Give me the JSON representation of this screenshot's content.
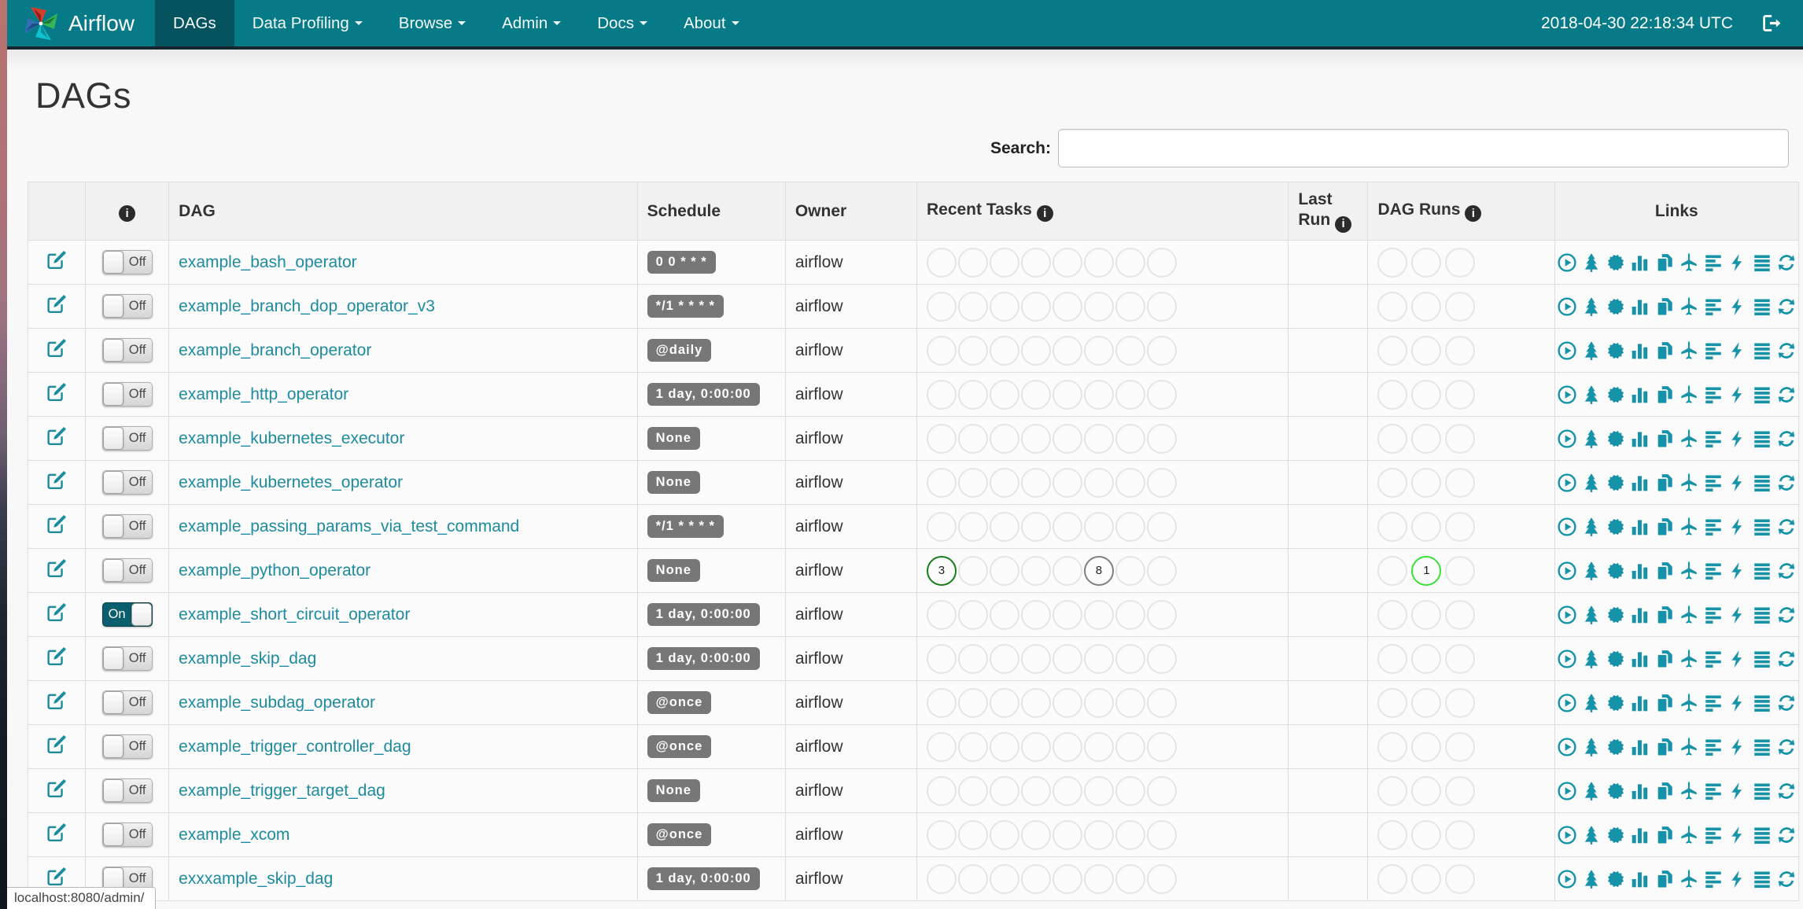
{
  "navbar": {
    "brand": "Airflow",
    "items": [
      {
        "label": "DAGs",
        "active": true,
        "caret": false
      },
      {
        "label": "Data Profiling",
        "active": false,
        "caret": true
      },
      {
        "label": "Browse",
        "active": false,
        "caret": true
      },
      {
        "label": "Admin",
        "active": false,
        "caret": true
      },
      {
        "label": "Docs",
        "active": false,
        "caret": true
      },
      {
        "label": "About",
        "active": false,
        "caret": true
      }
    ],
    "clock": "2018-04-30 22:18:34 UTC"
  },
  "page": {
    "title": "DAGs",
    "search_label": "Search:",
    "search_value": "",
    "status_bar": "localhost:8080/admin/"
  },
  "table": {
    "headers": {
      "dag": "DAG",
      "schedule": "Schedule",
      "owner": "Owner",
      "recent_tasks": "Recent Tasks",
      "last_run_line1": "Last",
      "last_run_line2": "Run",
      "dag_runs": "DAG Runs",
      "links": "Links"
    },
    "recent_task_slots": 8,
    "dag_run_slots": 3,
    "link_icons": [
      "trigger-dag",
      "tree-view",
      "graph-view",
      "task-duration",
      "task-tries",
      "landing-times",
      "gantt-view",
      "code-view",
      "task-details",
      "refresh"
    ],
    "rows": [
      {
        "toggle": "Off",
        "dag": "example_bash_operator",
        "schedule": "0 0 * * *",
        "owner": "airflow",
        "recent": {},
        "runs": {}
      },
      {
        "toggle": "Off",
        "dag": "example_branch_dop_operator_v3",
        "schedule": "*/1 * * * *",
        "owner": "airflow",
        "recent": {},
        "runs": {}
      },
      {
        "toggle": "Off",
        "dag": "example_branch_operator",
        "schedule": "@daily",
        "owner": "airflow",
        "recent": {},
        "runs": {}
      },
      {
        "toggle": "Off",
        "dag": "example_http_operator",
        "schedule": "1 day, 0:00:00",
        "owner": "airflow",
        "recent": {},
        "runs": {}
      },
      {
        "toggle": "Off",
        "dag": "example_kubernetes_executor",
        "schedule": "None",
        "owner": "airflow",
        "recent": {},
        "runs": {}
      },
      {
        "toggle": "Off",
        "dag": "example_kubernetes_operator",
        "schedule": "None",
        "owner": "airflow",
        "recent": {},
        "runs": {}
      },
      {
        "toggle": "Off",
        "dag": "example_passing_params_via_test_command",
        "schedule": "*/1 * * * *",
        "owner": "airflow",
        "recent": {},
        "runs": {}
      },
      {
        "toggle": "Off",
        "dag": "example_python_operator",
        "schedule": "None",
        "owner": "airflow",
        "recent": {
          "0": {
            "value": "3",
            "state": "success"
          },
          "5": {
            "value": "8",
            "state": "none"
          }
        },
        "runs": {
          "1": {
            "value": "1",
            "state": "running"
          }
        }
      },
      {
        "toggle": "On",
        "dag": "example_short_circuit_operator",
        "schedule": "1 day, 0:00:00",
        "owner": "airflow",
        "recent": {},
        "runs": {}
      },
      {
        "toggle": "Off",
        "dag": "example_skip_dag",
        "schedule": "1 day, 0:00:00",
        "owner": "airflow",
        "recent": {},
        "runs": {}
      },
      {
        "toggle": "Off",
        "dag": "example_subdag_operator",
        "schedule": "@once",
        "owner": "airflow",
        "recent": {},
        "runs": {}
      },
      {
        "toggle": "Off",
        "dag": "example_trigger_controller_dag",
        "schedule": "@once",
        "owner": "airflow",
        "recent": {},
        "runs": {}
      },
      {
        "toggle": "Off",
        "dag": "example_trigger_target_dag",
        "schedule": "None",
        "owner": "airflow",
        "recent": {},
        "runs": {}
      },
      {
        "toggle": "Off",
        "dag": "example_xcom",
        "schedule": "@once",
        "owner": "airflow",
        "recent": {},
        "runs": {}
      },
      {
        "toggle": "Off",
        "dag": "exxxample_skip_dag",
        "schedule": "1 day, 0:00:00",
        "owner": "airflow",
        "recent": {},
        "runs": {}
      }
    ]
  },
  "colors": {
    "navbar": "#067a87",
    "navbar_active": "#04535f",
    "link": "#1c8ba0",
    "icon": "#1693a9",
    "badge": "#777777",
    "state_success": "#167c16",
    "state_none": "#7f7f7f",
    "state_running": "#38e038"
  }
}
